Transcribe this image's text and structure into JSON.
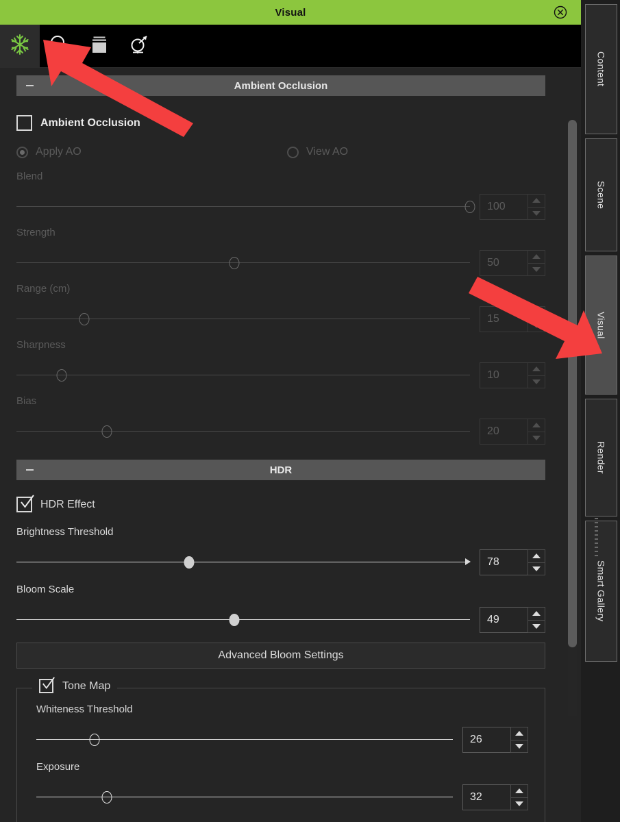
{
  "window": {
    "title": "Visual",
    "close_icon": "close-circle-icon",
    "accent_color": "#8cc63e"
  },
  "toolbar": {
    "items": [
      {
        "icon": "snowflake-icon",
        "selected": true
      },
      {
        "icon": "magnifier-icon",
        "selected": false
      },
      {
        "icon": "layers-box-icon",
        "selected": false
      },
      {
        "icon": "light-direction-icon",
        "selected": false
      }
    ]
  },
  "sections": {
    "ambient_occlusion": {
      "header": "Ambient Occlusion",
      "collapse_icon": "minus-icon",
      "enable_label": "Ambient Occlusion",
      "enabled": false,
      "radios": [
        {
          "label": "Apply AO",
          "selected": true
        },
        {
          "label": "View AO",
          "selected": false
        }
      ],
      "sliders": [
        {
          "label": "Blend",
          "value": "100",
          "percent": 100
        },
        {
          "label": "Strength",
          "value": "50",
          "percent": 48
        },
        {
          "label": "Range (cm)",
          "value": "15",
          "percent": 15
        },
        {
          "label": "Sharpness",
          "value": "10",
          "percent": 10
        },
        {
          "label": "Bias",
          "value": "20",
          "percent": 20
        }
      ]
    },
    "hdr": {
      "header": "HDR",
      "collapse_icon": "minus-icon",
      "enable_label": "HDR Effect",
      "enabled": true,
      "sliders": [
        {
          "label": "Brightness Threshold",
          "value": "78",
          "percent": 38,
          "arrow_end": true
        },
        {
          "label": "Bloom Scale",
          "value": "49",
          "percent": 48,
          "arrow_end": false
        }
      ],
      "advanced_button": "Advanced Bloom Settings",
      "tone_map": {
        "label": "Tone Map",
        "enabled": true,
        "sliders": [
          {
            "label": "Whiteness Threshold",
            "value": "26",
            "percent": 14
          },
          {
            "label": "Exposure",
            "value": "32",
            "percent": 17
          }
        ]
      }
    }
  },
  "tabs": [
    {
      "label": "Content",
      "active": false
    },
    {
      "label": "Scene",
      "active": false
    },
    {
      "label": "Visual",
      "active": true
    },
    {
      "label": "Render",
      "active": false
    },
    {
      "label": "Smart Gallery",
      "active": false
    }
  ]
}
